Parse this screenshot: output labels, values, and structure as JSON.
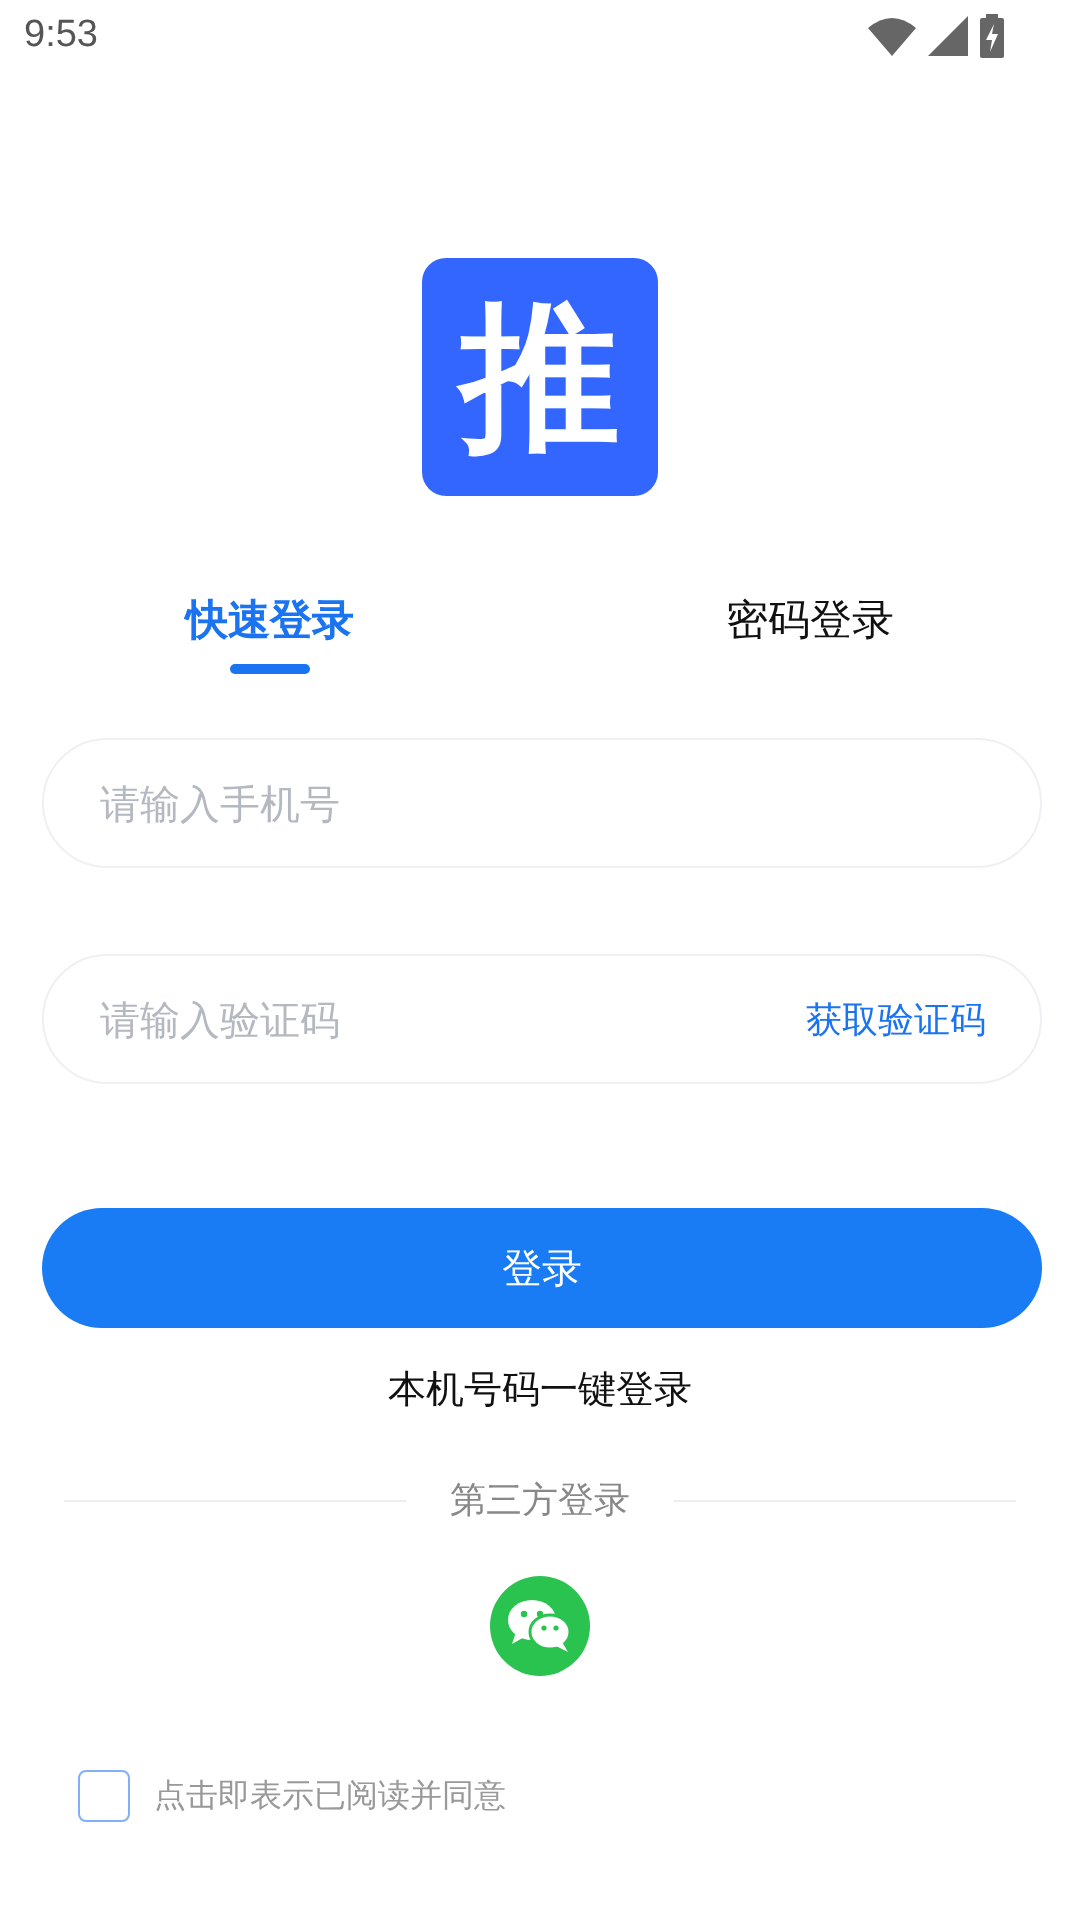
{
  "status_bar": {
    "time": "9:53"
  },
  "logo": {
    "text": "推"
  },
  "tabs": [
    {
      "label": "快速登录",
      "selected": true
    },
    {
      "label": "密码登录",
      "selected": false
    }
  ],
  "phone_field": {
    "placeholder": "请输入手机号"
  },
  "code_field": {
    "placeholder": "请输入验证码",
    "action": "获取验证码"
  },
  "login_button": "登录",
  "one_key_login": "本机号码一键登录",
  "third_party": {
    "label": "第三方登录"
  },
  "agreement": {
    "checked": false,
    "text": "点击即表示已阅读并同意"
  }
}
